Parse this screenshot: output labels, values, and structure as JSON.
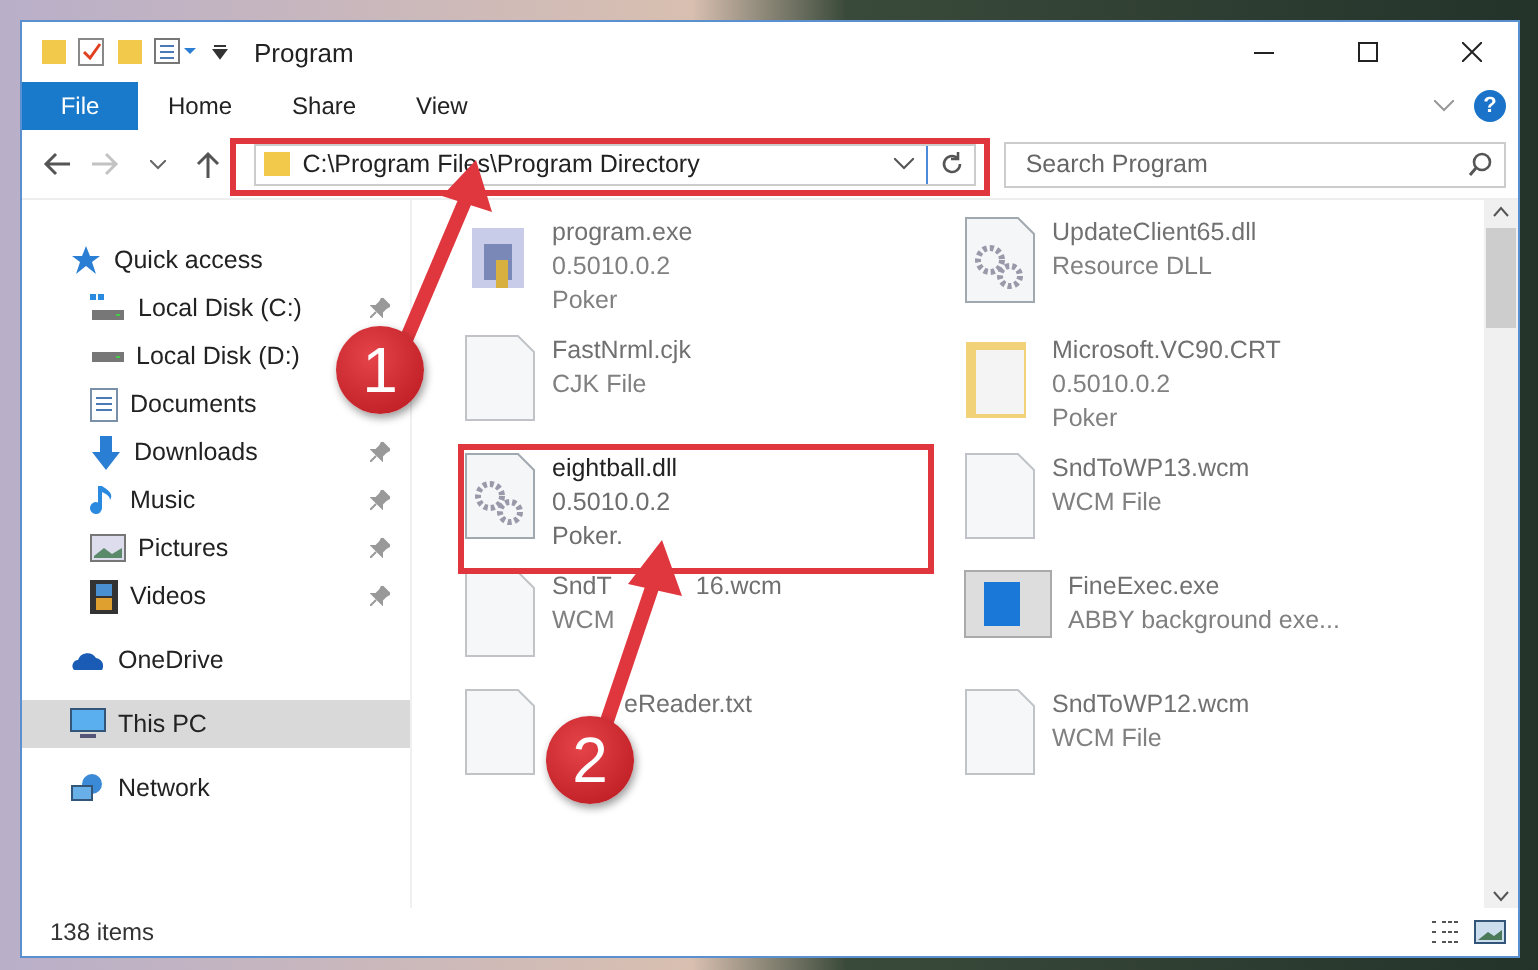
{
  "window": {
    "title": "Program"
  },
  "ribbon": {
    "tabs": [
      {
        "label": "File",
        "selected": true
      },
      {
        "label": "Home",
        "selected": false
      },
      {
        "label": "Share",
        "selected": false
      },
      {
        "label": "View",
        "selected": false
      }
    ],
    "help": "?"
  },
  "address": {
    "path": "C:\\Program Files\\Program Directory",
    "search_placeholder": "Search Program",
    "forward_disabled": true
  },
  "nav": [
    {
      "label": "Quick access",
      "kind": "group",
      "pinned": false,
      "selected": false
    },
    {
      "label": "Local Disk (C:)",
      "kind": "item",
      "pinned": true,
      "selected": false
    },
    {
      "label": "Local Disk (D:)",
      "kind": "item",
      "pinned": false,
      "selected": false
    },
    {
      "label": "Documents",
      "kind": "item",
      "pinned": false,
      "selected": false
    },
    {
      "label": "Downloads",
      "kind": "item",
      "pinned": true,
      "selected": false
    },
    {
      "label": "Music",
      "kind": "item",
      "pinned": true,
      "selected": false
    },
    {
      "label": "Pictures",
      "kind": "item",
      "pinned": true,
      "selected": false
    },
    {
      "label": "Videos",
      "kind": "item",
      "pinned": true,
      "selected": false
    },
    {
      "label": "OneDrive",
      "kind": "group",
      "pinned": false,
      "selected": false
    },
    {
      "label": "This PC",
      "kind": "group",
      "pinned": false,
      "selected": true
    },
    {
      "label": "Network",
      "kind": "group",
      "pinned": false,
      "selected": false
    }
  ],
  "files": [
    {
      "kind": "exe",
      "name": "program.exe",
      "lines": [
        "0.5010.0.2",
        "Poker"
      ],
      "focus": false
    },
    {
      "kind": "dll",
      "name": "UpdateClient65.dll",
      "lines": [
        "Resource DLL"
      ],
      "focus": false
    },
    {
      "kind": "blank",
      "name": "FastNrml.cjk",
      "lines": [
        "CJK File"
      ],
      "focus": false
    },
    {
      "kind": "folder",
      "name": "Microsoft.VC90.CRT",
      "lines": [
        "0.5010.0.2",
        "Poker"
      ],
      "focus": false
    },
    {
      "kind": "dll",
      "name": "eightball.dll",
      "lines": [
        "0.5010.0.2",
        "Poker."
      ],
      "focus": true
    },
    {
      "kind": "blank",
      "name": "SndToWP13.wcm",
      "lines": [
        "WCM File"
      ],
      "focus": false
    },
    {
      "kind": "blank",
      "name": "SndT",
      "tail": "16.wcm",
      "lines": [
        "WCM"
      ],
      "focus": false
    },
    {
      "kind": "app",
      "name": "FineExec.exe",
      "lines": [
        "ABBY background exe..."
      ],
      "focus": false
    },
    {
      "kind": "blank",
      "name": "eReader.txt",
      "covered": true,
      "focus": false
    },
    {
      "kind": "blank",
      "name": "SndToWP12.wcm",
      "lines": [
        "WCM File"
      ],
      "focus": false
    }
  ],
  "status": {
    "count": "138 items"
  },
  "callouts": [
    "1",
    "2"
  ]
}
